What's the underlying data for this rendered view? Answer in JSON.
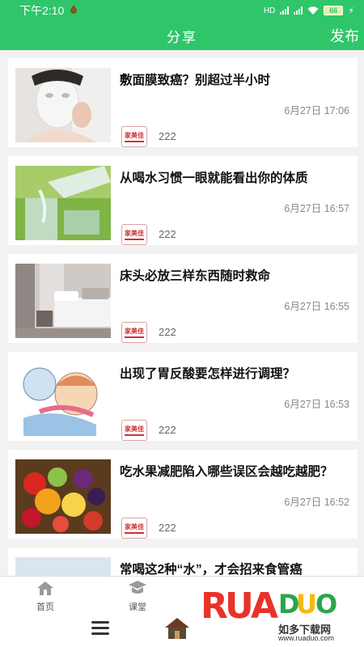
{
  "status_bar": {
    "time": "下午2:10",
    "network": "HD",
    "battery": "66"
  },
  "header": {
    "title": "分享",
    "action": "发布"
  },
  "articles": [
    {
      "title": "敷面膜致癌？别超过半小时",
      "date": "6月27日 17:06",
      "source": "222",
      "image": "face-mask-photo"
    },
    {
      "title": "从喝水习惯一眼就能看出你的体质",
      "date": "6月27日 16:57",
      "source": "222",
      "image": "water-glass-photo"
    },
    {
      "title": "床头必放三样东西随时救命",
      "date": "6月27日 16:55",
      "source": "222",
      "image": "bedroom-photo"
    },
    {
      "title": "出现了胃反酸要怎样进行调理？",
      "date": "6月27日 16:53",
      "source": "222",
      "image": "acid-reflux-illustration"
    },
    {
      "title": "吃水果减肥陷入哪些误区会越吃越肥？",
      "date": "6月27日 16:52",
      "source": "222",
      "image": "fruit-basket-photo"
    },
    {
      "title": "常喝这2种“水”，才会招来食管癌",
      "date": "",
      "source": "",
      "image": "partial-photo"
    }
  ],
  "source_logo_text": "家美佳",
  "tabs": [
    {
      "label": "首页",
      "icon": "home-icon"
    },
    {
      "label": "课堂",
      "icon": "classroom-icon"
    }
  ],
  "watermark": {
    "logo": "RUADUO",
    "sub": "如多下载网",
    "url": "www.ruaduo.com"
  },
  "colors": {
    "brand_green": "#2fc66a",
    "watermark_red": "#e8322b",
    "watermark_yellow": "#f5b90a",
    "watermark_green": "#2aa64a"
  }
}
